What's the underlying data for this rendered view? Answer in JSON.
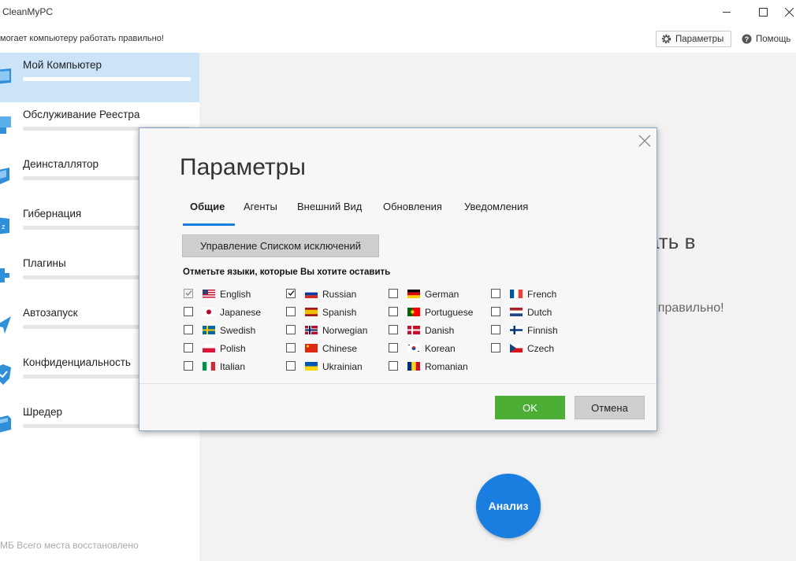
{
  "window": {
    "title": "CleanMyPC"
  },
  "header": {
    "slogan": "могает компьютеру работать правильно!",
    "params_label": "Параметры",
    "help_label": "Помощь"
  },
  "sidebar": {
    "items": [
      {
        "label": "Мой Компьютер",
        "icon": "computer-icon",
        "active": true
      },
      {
        "label": "Обслуживание Реестра",
        "icon": "registry-icon"
      },
      {
        "label": "Деинсталлятор",
        "icon": "uninstaller-icon"
      },
      {
        "label": "Гибернация",
        "icon": "hibernation-icon"
      },
      {
        "label": "Плагины",
        "icon": "plugins-icon"
      },
      {
        "label": "Автозапуск",
        "icon": "autorun-icon"
      },
      {
        "label": "Конфиденциальность",
        "icon": "privacy-icon"
      },
      {
        "label": "Шредер",
        "icon": "shredder-icon"
      }
    ],
    "footer": "МБ Всего места восстановлено"
  },
  "main": {
    "hero_partial": "ать в",
    "hero_sub_partial": "ь правильно!",
    "analyze_label": "Анализ"
  },
  "dialog": {
    "title": "Параметры",
    "tabs": [
      "Общие",
      "Агенты",
      "Внешний Вид",
      "Обновления",
      "Уведомления"
    ],
    "active_tab": 0,
    "exclusions_button": "Управление Списком исключений",
    "languages_title": "Отметьте языки, которые Вы хотите оставить",
    "languages": [
      {
        "name": "English",
        "checked": true,
        "disabled": true,
        "flag": "flag-us"
      },
      {
        "name": "Japanese",
        "checked": false,
        "flag": "flag-jp"
      },
      {
        "name": "Swedish",
        "checked": false,
        "flag": "flag-se"
      },
      {
        "name": "Polish",
        "checked": false,
        "flag": "flag-pl"
      },
      {
        "name": "Italian",
        "checked": false,
        "flag": "flag-it"
      },
      {
        "name": "Russian",
        "checked": true,
        "flag": "flag-ru"
      },
      {
        "name": "Spanish",
        "checked": false,
        "flag": "flag-es"
      },
      {
        "name": "Norwegian",
        "checked": false,
        "flag": "flag-no"
      },
      {
        "name": "Chinese",
        "checked": false,
        "flag": "flag-cn"
      },
      {
        "name": "Ukrainian",
        "checked": false,
        "flag": "flag-ua"
      },
      {
        "name": "German",
        "checked": false,
        "flag": "flag-de"
      },
      {
        "name": "Portuguese",
        "checked": false,
        "flag": "flag-pt"
      },
      {
        "name": "Danish",
        "checked": false,
        "flag": "flag-dk"
      },
      {
        "name": "Korean",
        "checked": false,
        "flag": "flag-kr"
      },
      {
        "name": "Romanian",
        "checked": false,
        "flag": "flag-ro"
      },
      {
        "name": "French",
        "checked": false,
        "flag": "flag-fr"
      },
      {
        "name": "Dutch",
        "checked": false,
        "flag": "flag-nl"
      },
      {
        "name": "Finnish",
        "checked": false,
        "flag": "flag-fi"
      },
      {
        "name": "Czech",
        "checked": false,
        "flag": "flag-cz"
      }
    ],
    "ok_label": "OK",
    "cancel_label": "Отмена"
  },
  "colors": {
    "accent": "#1a7ee0",
    "ok_green": "#4cae34",
    "sidebar_active": "#cce4f7"
  }
}
